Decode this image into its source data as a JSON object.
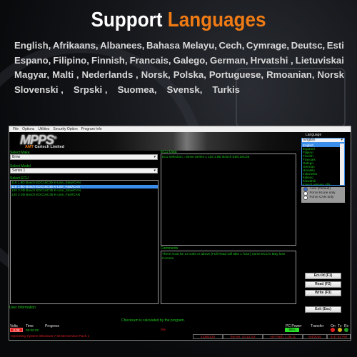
{
  "banner": {
    "title_white": "Support",
    "title_orange": "Languages",
    "language_rows": [
      [
        "English,",
        "Afrikaans,",
        "Albanees,",
        "Bahasa Melayu,",
        "Cech,",
        "Cymrage,",
        "Deutsc,",
        "Esti"
      ],
      [
        "Espano,",
        "Filipino,",
        "Finnish,",
        "Francais,",
        "Galego,",
        "German,",
        "Hrvatshi ,",
        "Lietuviskai"
      ],
      [
        "Magyar,",
        "Malti ,",
        "Nederlands ,",
        "Norsk,",
        "Polska,",
        "Portuguese,",
        "Rmoanian,",
        "Norsk"
      ],
      [
        "Slovenski ,",
        "Srpski ,",
        "Suomea,",
        "Svensk,",
        "Turkis"
      ]
    ]
  },
  "app": {
    "menu": [
      "File",
      "Options",
      "Utilities",
      "Security Option",
      "Program Info"
    ],
    "logo": "MPPS",
    "logo_reg": "®",
    "logo_sub_a": "AMT",
    "logo_sub_b": " Cartech Limited",
    "select_make_label": "Select Make",
    "select_make_value": "Bmw",
    "select_model_label": "Select Model",
    "select_model_value": "Series 1",
    "select_ecu_label": "Select ECU",
    "ecu_items": [
      "118 1.8D Bosch EDC16C35 K-Line_Slow/CAN",
      "118 1.8D Bosch EDC16C35 K-Line_Fast/CAN",
      "120 2.0D Bosch EDC16C35 K-Line_Slow/CAN",
      "120 2.0D Bosch EDC16C35 K-Line_Fast/CAN"
    ],
    "ecu_selected_index": 1,
    "ecu_data_label": "ECU Data",
    "ecu_data_text": "Ecu Selection = Bmw Series 1 118 1.8D Bosch EDC16C35",
    "comments_label": "Comments",
    "comments_text": "There must be 13 volts or above (Full Read will take 1 hour) Some ECU's May lose Comms",
    "language_label": "Language",
    "language_value": "English",
    "language_options": [
      "English",
      "Espanol",
      "Filipino",
      "Finnish",
      "Francais",
      "Galego",
      "German",
      "Hrvatski",
      "Indonesia",
      "Italiano",
      "Kiswahili",
      "Kreyol ayisyen alfa"
    ],
    "protocol_options": [
      {
        "label": "Auto (Default)",
        "checked": true
      },
      {
        "label": "Force KLine only",
        "checked": false
      },
      {
        "label": "Force CAN only",
        "checked": false
      }
    ],
    "buttons": {
      "ecu_id": "Ecu Id   (F1)",
      "read": "Read   (F2)",
      "write": "Write   (F3)",
      "exit": "Exit   (Esc)"
    },
    "user_info_label": "User Information",
    "checksum_text": "Checksum is calculated by the program.",
    "volts_label": "Volts",
    "volts_value": "0.00",
    "time_label": "Time",
    "time_value": "00:00:00",
    "progress_label": "Progress",
    "progress_value": "0%",
    "pc_power_label": "PC Power",
    "pc_power_value": "85%",
    "transfer_label": "Transfer",
    "led_labels": [
      "On",
      "Tx",
      "Rx"
    ],
    "led_colors": [
      "#e02020",
      "#d8b020",
      "#20a020"
    ],
    "os_text": "Operating System Windows 7 64 Bit Service Pack 1",
    "status_cells": [
      "41363120",
      "Sw.Ver. 10.13.3.8",
      "Ant Flash. 1.08.11",
      "6/4/2016",
      "6:47:40 PM"
    ]
  }
}
